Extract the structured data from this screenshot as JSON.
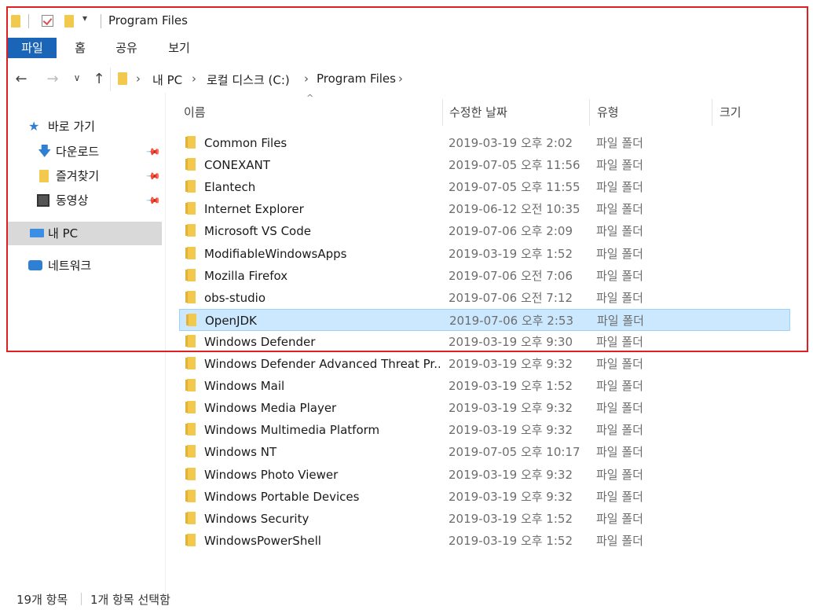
{
  "window": {
    "title": "Program Files"
  },
  "ribbon": {
    "tabs": [
      "파일",
      "홈",
      "공유",
      "보기"
    ]
  },
  "address": {
    "crumbs": [
      "내 PC",
      "로컬 디스크 (C:)",
      "Program Files"
    ]
  },
  "sidebar": {
    "quick_access": "바로 가기",
    "pinned": [
      "다운로드",
      "즐겨찾기",
      "동영상"
    ],
    "this_pc": "내 PC",
    "network": "네트워크"
  },
  "columns": {
    "name": "이름",
    "modified": "수정한 날짜",
    "type": "유형",
    "size": "크기"
  },
  "files": [
    {
      "name": "Common Files",
      "date": "2019-03-19 오후 2:02",
      "type": "파일 폴더"
    },
    {
      "name": "CONEXANT",
      "date": "2019-07-05 오후 11:56",
      "type": "파일 폴더"
    },
    {
      "name": "Elantech",
      "date": "2019-07-05 오후 11:55",
      "type": "파일 폴더"
    },
    {
      "name": "Internet Explorer",
      "date": "2019-06-12 오전 10:35",
      "type": "파일 폴더"
    },
    {
      "name": "Microsoft VS Code",
      "date": "2019-07-06 오후 2:09",
      "type": "파일 폴더"
    },
    {
      "name": "ModifiableWindowsApps",
      "date": "2019-03-19 오후 1:52",
      "type": "파일 폴더"
    },
    {
      "name": "Mozilla Firefox",
      "date": "2019-07-06 오전 7:06",
      "type": "파일 폴더"
    },
    {
      "name": "obs-studio",
      "date": "2019-07-06 오전 7:12",
      "type": "파일 폴더"
    },
    {
      "name": "OpenJDK",
      "date": "2019-07-06 오후 2:53",
      "type": "파일 폴더",
      "selected": true
    },
    {
      "name": "Windows Defender",
      "date": "2019-03-19 오후 9:30",
      "type": "파일 폴더"
    },
    {
      "name": "Windows Defender Advanced Threat Pr...",
      "date": "2019-03-19 오후 9:32",
      "type": "파일 폴더"
    },
    {
      "name": "Windows Mail",
      "date": "2019-03-19 오후 1:52",
      "type": "파일 폴더"
    },
    {
      "name": "Windows Media Player",
      "date": "2019-03-19 오후 9:32",
      "type": "파일 폴더"
    },
    {
      "name": "Windows Multimedia Platform",
      "date": "2019-03-19 오후 9:32",
      "type": "파일 폴더"
    },
    {
      "name": "Windows NT",
      "date": "2019-07-05 오후 10:17",
      "type": "파일 폴더"
    },
    {
      "name": "Windows Photo Viewer",
      "date": "2019-03-19 오후 9:32",
      "type": "파일 폴더"
    },
    {
      "name": "Windows Portable Devices",
      "date": "2019-03-19 오후 9:32",
      "type": "파일 폴더"
    },
    {
      "name": "Windows Security",
      "date": "2019-03-19 오후 1:52",
      "type": "파일 폴더"
    },
    {
      "name": "WindowsPowerShell",
      "date": "2019-03-19 오후 1:52",
      "type": "파일 폴더"
    }
  ],
  "status": {
    "count": "19개 항목",
    "selected": "1개 항목 선택함"
  },
  "colors": {
    "accent": "#1a65b7",
    "selection": "#cce8ff",
    "folder": "#f2c94c",
    "highlight_box": "#e02020"
  }
}
